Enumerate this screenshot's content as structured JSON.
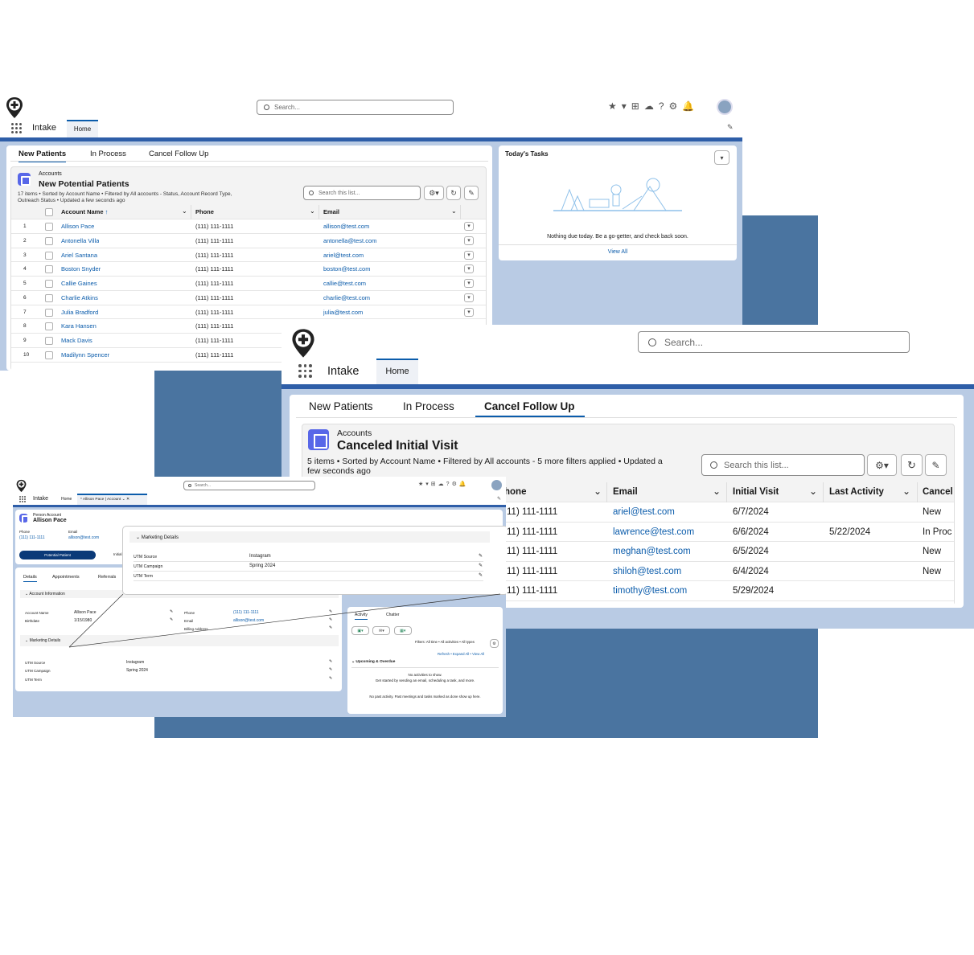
{
  "back_window": {
    "search_placeholder": "Search...",
    "app_name": "Intake",
    "nav_tab": "Home",
    "subtabs": [
      "New Patients",
      "In Process",
      "Cancel Follow Up"
    ],
    "list": {
      "object": "Accounts",
      "title": "New Potential Patients",
      "meta_line1": "17 items • Sorted by Account Name • Filtered by All accounts - Status, Account Record Type,",
      "meta_line2": "Outreach Status • Updated a few seconds ago",
      "search_placeholder": "Search this list...",
      "columns": [
        "Account Name",
        "Phone",
        "Email"
      ],
      "sort_arrow": "↑",
      "rows": [
        {
          "n": "1",
          "name": "Allison Pace",
          "phone": "(111) 111-1111",
          "email": "allison@test.com"
        },
        {
          "n": "2",
          "name": "Antonella Villa",
          "phone": "(111) 111-1111",
          "email": "antonella@test.com"
        },
        {
          "n": "3",
          "name": "Ariel Santana",
          "phone": "(111) 111-1111",
          "email": "ariel@test.com"
        },
        {
          "n": "4",
          "name": "Boston Snyder",
          "phone": "(111) 111-1111",
          "email": "boston@test.com"
        },
        {
          "n": "5",
          "name": "Callie Gaines",
          "phone": "(111) 111-1111",
          "email": "callie@test.com"
        },
        {
          "n": "6",
          "name": "Charlie Atkins",
          "phone": "(111) 111-1111",
          "email": "charlie@test.com"
        },
        {
          "n": "7",
          "name": "Julia Bradford",
          "phone": "(111) 111-1111",
          "email": "julia@test.com"
        },
        {
          "n": "8",
          "name": "Kara Hansen",
          "phone": "(111) 111-1111",
          "email": ""
        },
        {
          "n": "9",
          "name": "Mack Davis",
          "phone": "(111) 111-1111",
          "email": ""
        },
        {
          "n": "10",
          "name": "Madilynn Spencer",
          "phone": "(111) 111-1111",
          "email": ""
        }
      ]
    },
    "tasks": {
      "title": "Today's Tasks",
      "empty_text": "Nothing due today. Be a go-getter, and check back soon.",
      "view_all": "View All"
    }
  },
  "front_window": {
    "search_placeholder": "Search...",
    "app_name": "Intake",
    "nav_tab": "Home",
    "subtabs": [
      "New Patients",
      "In Process",
      "Cancel Follow Up"
    ],
    "list": {
      "object": "Accounts",
      "title": "Canceled Initial Visit",
      "meta_line1": "5 items • Sorted by Account Name • Filtered by All accounts - 5 more filters applied • Updated a",
      "meta_line2": "few seconds ago",
      "search_placeholder": "Search this list...",
      "columns": [
        "hone",
        "Email",
        "Initial Visit",
        "Last Activity",
        "Cancel"
      ],
      "rows": [
        {
          "phone": "11) 111-1111",
          "email": "ariel@test.com",
          "visit": "6/7/2024",
          "activity": "",
          "cancel": "New"
        },
        {
          "phone": "11) 111-1111",
          "email": "lawrence@test.com",
          "visit": "6/6/2024",
          "activity": "5/22/2024",
          "cancel": "In Proc"
        },
        {
          "phone": "11) 111-1111",
          "email": "meghan@test.com",
          "visit": "6/5/2024",
          "activity": "",
          "cancel": "New"
        },
        {
          "phone": "11) 111-1111",
          "email": "shiloh@test.com",
          "visit": "6/4/2024",
          "activity": "",
          "cancel": "New"
        },
        {
          "phone": "11) 111-1111",
          "email": "timothy@test.com",
          "visit": "5/29/2024",
          "activity": "",
          "cancel": ""
        }
      ]
    }
  },
  "record_window": {
    "search_placeholder": "Search...",
    "app_name": "Intake",
    "nav_tab": "Home",
    "record_tab": "* Allison Pace | Account",
    "record_type": "Person Account",
    "record_name": "Allison Pace",
    "phone_label": "Phone",
    "phone_value": "(111) 111-1111",
    "email_label": "Email",
    "email_value": "allison@test.com",
    "path_current": "Potential Patient",
    "path_next": "Initial",
    "tabs": [
      "Details",
      "Appointments",
      "Referrals"
    ],
    "account_info_title": "Account Information",
    "fields": {
      "account_name_label": "Account Name",
      "account_name": "Allison Pace",
      "birthdate_label": "Birthdate",
      "birthdate": "1/15/1980",
      "phone_label": "Phone",
      "phone": "(111) 111-1111",
      "email_label": "Email",
      "email": "allison@test.com",
      "billing_label": "Billing Address"
    },
    "marketing_title": "Marketing Details",
    "utm_source_label": "UTM Source",
    "utm_source": "Instagram",
    "utm_campaign_label": "UTM Campaign",
    "utm_campaign": "Spring 2024",
    "utm_term_label": "UTM Term",
    "callout": {
      "title": "Marketing Details",
      "utm_source_label": "UTM Source",
      "utm_source": "Instagram",
      "utm_campaign_label": "UTM Campaign",
      "utm_campaign": "Spring 2024",
      "utm_term_label": "UTM Term"
    },
    "activity": {
      "tabs": [
        "Activity",
        "Chatter"
      ],
      "filters": "Filters: All time • All activities • All types",
      "links": "Refresh • Expand All • View All",
      "upcoming": "Upcoming & Overdue",
      "no_activities": "No activities to show.",
      "get_started": "Get started by sending an email, scheduling a task, and more.",
      "no_past": "No past activity. Past meetings and tasks marked as done show up here."
    }
  },
  "colors": {
    "nav_blue": "#2e5ea8",
    "steel_blue": "#4a74a0",
    "pale_blue": "#b9cbe4",
    "link": "#0b5cab",
    "icon_purple": "#5867e8",
    "path_navy": "#0b3a78"
  }
}
